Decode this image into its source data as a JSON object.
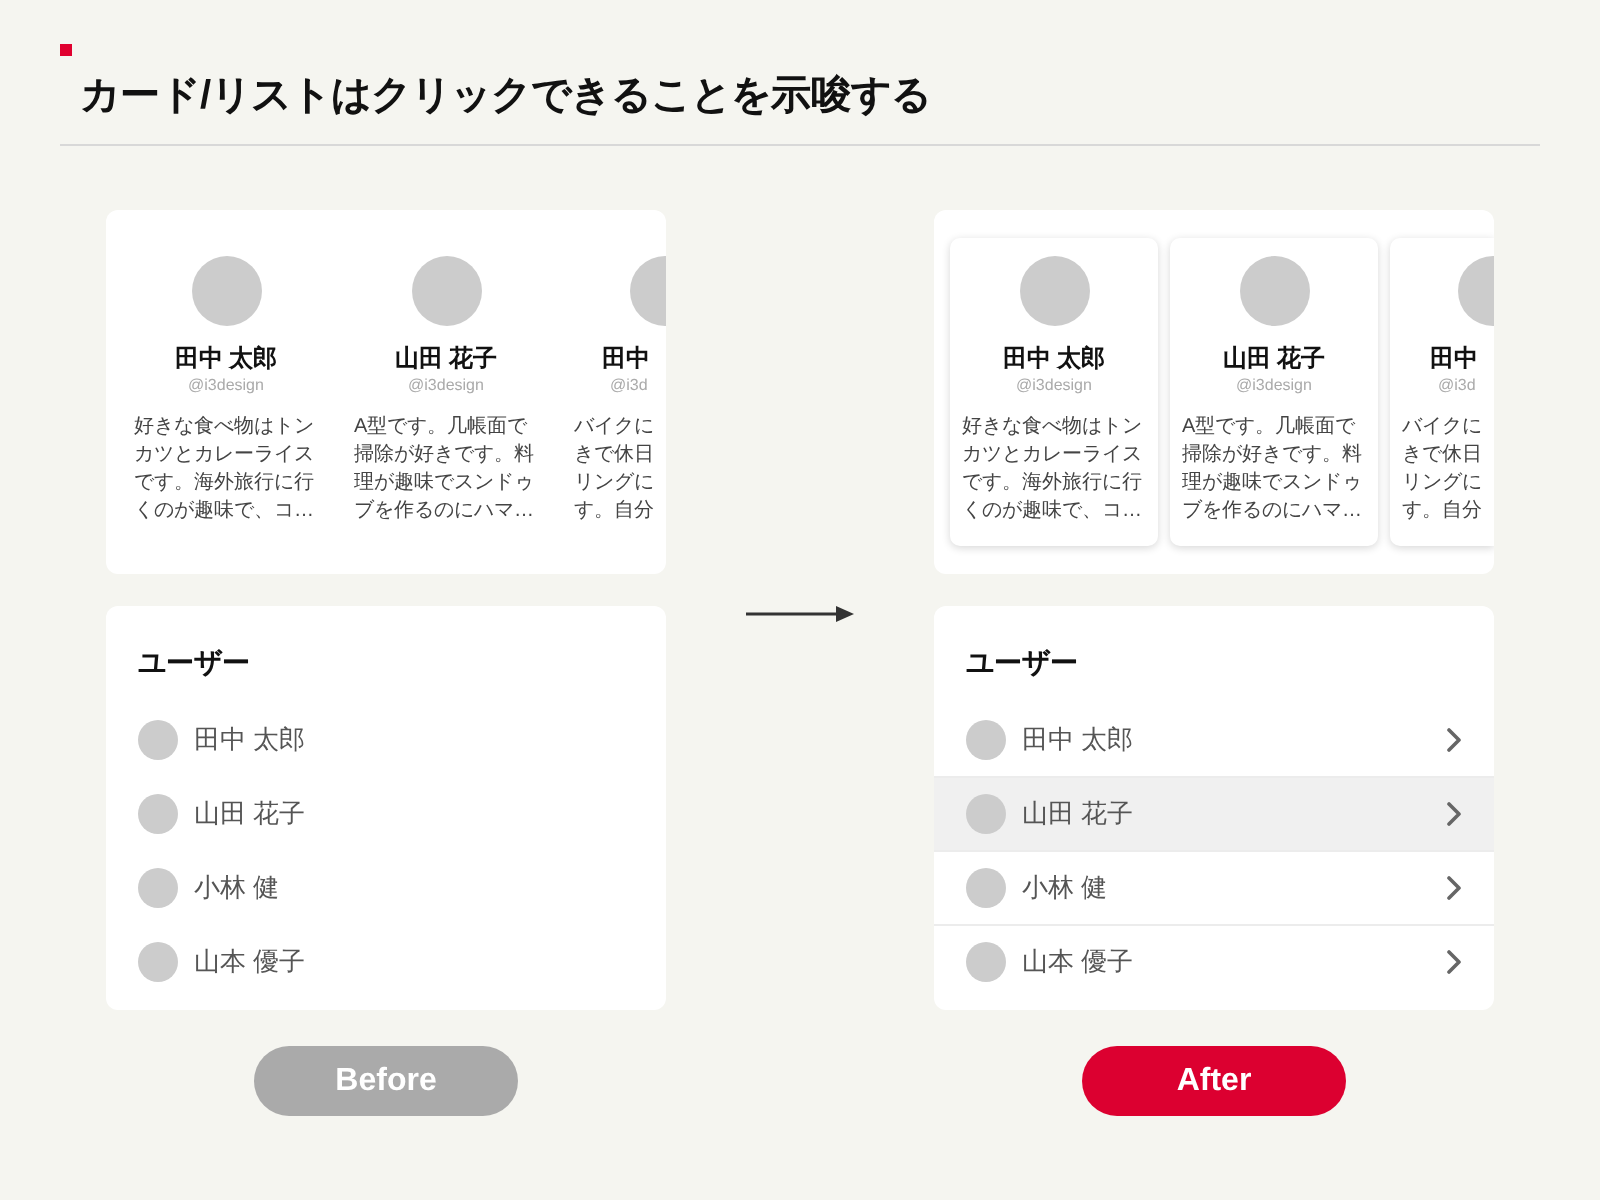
{
  "title": "カード/リストはクリックできることを示唆する",
  "panels": [
    {
      "kind": "before",
      "cards": [
        {
          "name": "田中 太郎",
          "handle": "@i3design",
          "description": "好きな食べ物はトンカツとカレーライスです。海外旅行に行くのが趣味で、コ…",
          "partial": false
        },
        {
          "name": "山田 花子",
          "handle": "@i3design",
          "description": "A型です。几帳面で掃除が好きです。料理が趣味でスンドゥブを作るのにハマ…",
          "partial": false
        },
        {
          "name": "田中",
          "handle": "@i3d",
          "description": "バイクにきで休日リングにす。自分",
          "partial": true
        }
      ],
      "list": {
        "heading": "ユーザー",
        "items": [
          {
            "name": "田中 太郎",
            "selected": false
          },
          {
            "name": "山田 花子",
            "selected": false
          },
          {
            "name": "小林 健",
            "selected": false
          },
          {
            "name": "山本 優子",
            "selected": false
          }
        ]
      },
      "caption": "Before"
    },
    {
      "kind": "after",
      "cards": [
        {
          "name": "田中 太郎",
          "handle": "@i3design",
          "description": "好きな食べ物はトンカツとカレーライスです。海外旅行に行くのが趣味で、コ…",
          "partial": false
        },
        {
          "name": "山田 花子",
          "handle": "@i3design",
          "description": "A型です。几帳面で掃除が好きです。料理が趣味でスンドゥブを作るのにハマ…",
          "partial": false
        },
        {
          "name": "田中",
          "handle": "@i3d",
          "description": "バイクにきで休日リングにす。自分",
          "partial": true
        }
      ],
      "list": {
        "heading": "ユーザー",
        "items": [
          {
            "name": "田中 太郎",
            "selected": false
          },
          {
            "name": "山田 花子",
            "selected": true
          },
          {
            "name": "小林 健",
            "selected": false
          },
          {
            "name": "山本 優子",
            "selected": false
          }
        ]
      },
      "caption": "After"
    }
  ]
}
